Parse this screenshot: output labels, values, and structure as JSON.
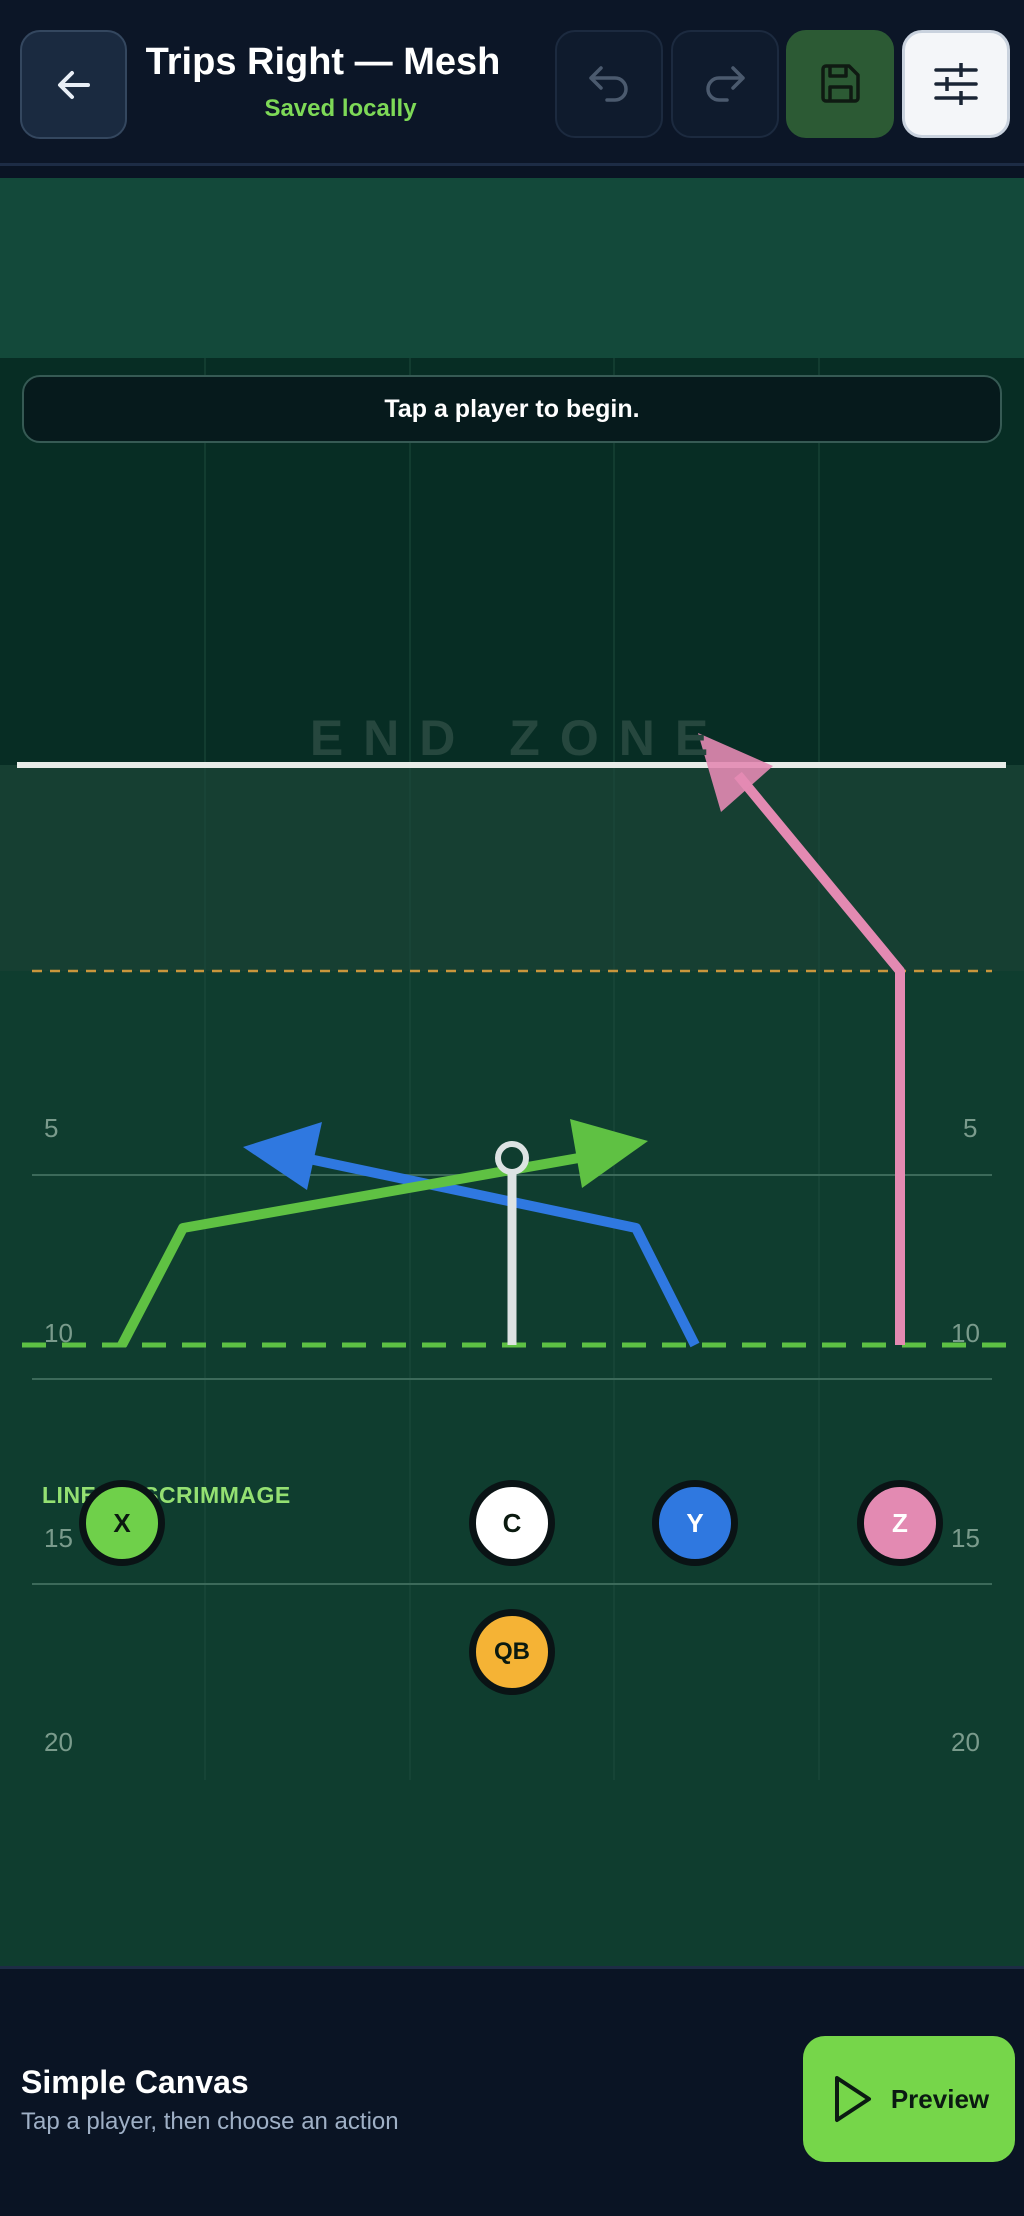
{
  "header": {
    "title": "Trips Right — Mesh",
    "status": "Saved locally",
    "buttons": {
      "back": {
        "icon": "arrow-left-icon",
        "enabled": true
      },
      "undo": {
        "icon": "undo-icon",
        "enabled": false
      },
      "redo": {
        "icon": "redo-icon",
        "enabled": false
      },
      "save": {
        "icon": "save-icon",
        "enabled": true
      },
      "settings": {
        "icon": "sliders-icon",
        "enabled": true
      }
    }
  },
  "field": {
    "hint": "Tap a player to begin.",
    "end_zone_label": "END ZONE",
    "yard_markers": [
      "5",
      "10",
      "15",
      "20"
    ],
    "line_of_scrimmage_label": "LINE OF SCRIMMAGE",
    "players": [
      {
        "id": "x",
        "label": "X",
        "color": "#6fd04a",
        "route": "cross"
      },
      {
        "id": "c",
        "label": "C",
        "color": "#ffffff",
        "route": "block"
      },
      {
        "id": "y",
        "label": "Y",
        "color": "#2f78e0",
        "route": "cross"
      },
      {
        "id": "z",
        "label": "Z",
        "color": "#e38ab2",
        "route": "post"
      },
      {
        "id": "qb",
        "label": "QB",
        "color": "#f5b335",
        "route": "none"
      }
    ],
    "colors": {
      "turf": "#0f3d2f",
      "end_zone": "#072d24",
      "line_of_scrimmage": "#5dc044",
      "first_down_line": "#c9963c",
      "goal_line": "#e8ece8"
    }
  },
  "bottom_bar": {
    "mode_title": "Simple Canvas",
    "mode_subtitle": "Tap a player, then choose an action",
    "preview_label": "Preview",
    "preview_icon": "play-icon"
  }
}
